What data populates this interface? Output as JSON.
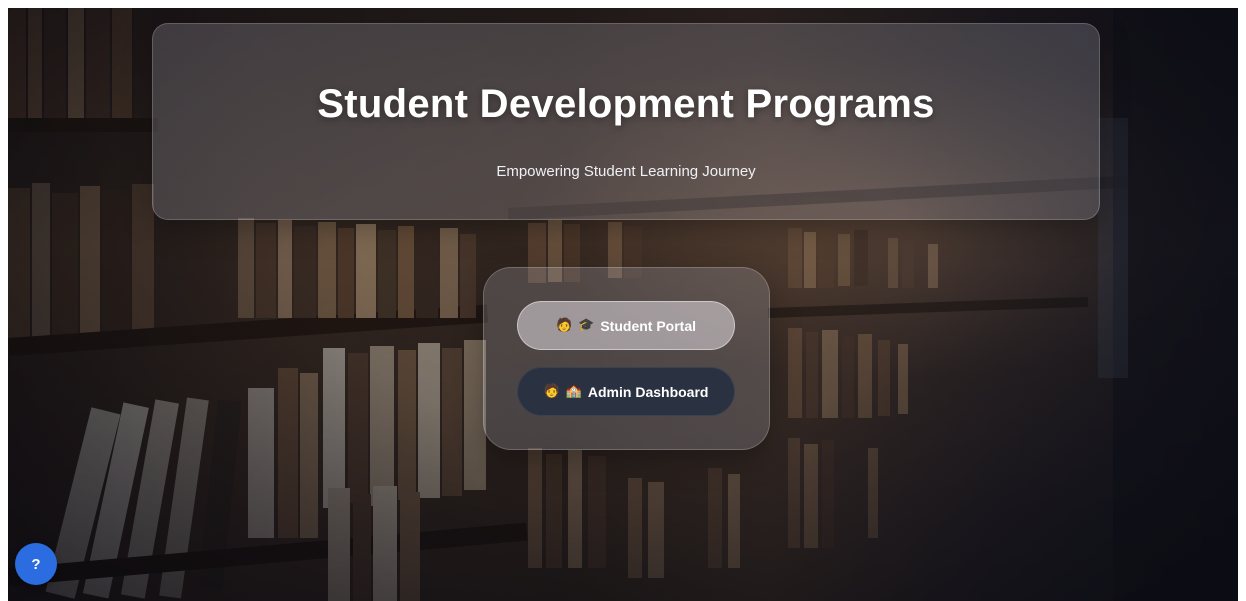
{
  "hero": {
    "title": "Student Development Programs",
    "subtitle": "Empowering Student Learning Journey"
  },
  "portal": {
    "student_button": {
      "icons": [
        "student-emoji",
        "graduation-cap-emoji"
      ],
      "icon_glyphs": [
        "🧑",
        "🎓"
      ],
      "label": "Student Portal"
    },
    "admin_button": {
      "icons": [
        "person-emoji",
        "school-emoji"
      ],
      "icon_glyphs": [
        "🧑",
        "🏫"
      ],
      "label": "Admin Dashboard"
    }
  },
  "help_button": {
    "label": "?",
    "color": "#2b6de0"
  },
  "background": {
    "description_icon": "library-bookshelves-photo"
  }
}
